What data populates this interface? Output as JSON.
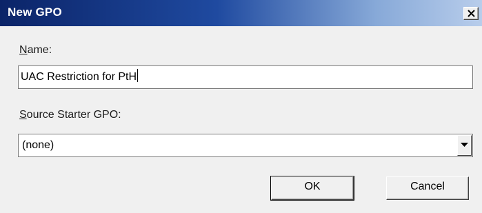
{
  "window": {
    "title": "New GPO",
    "close_icon": "close-icon"
  },
  "form": {
    "name_label_mnemonic": "N",
    "name_label_rest": "ame:",
    "name_value": "UAC Restriction for PtH",
    "source_label_mnemonic": "S",
    "source_label_rest": "ource Starter GPO:",
    "source_selected": "(none)",
    "dropdown_icon": "chevron-down-icon"
  },
  "buttons": {
    "ok_label": "OK",
    "cancel_label": "Cancel"
  },
  "colors": {
    "titlebar_start": "#0b2468",
    "titlebar_end": "#b8cdeb",
    "dialog_background": "#f0f0f0"
  }
}
